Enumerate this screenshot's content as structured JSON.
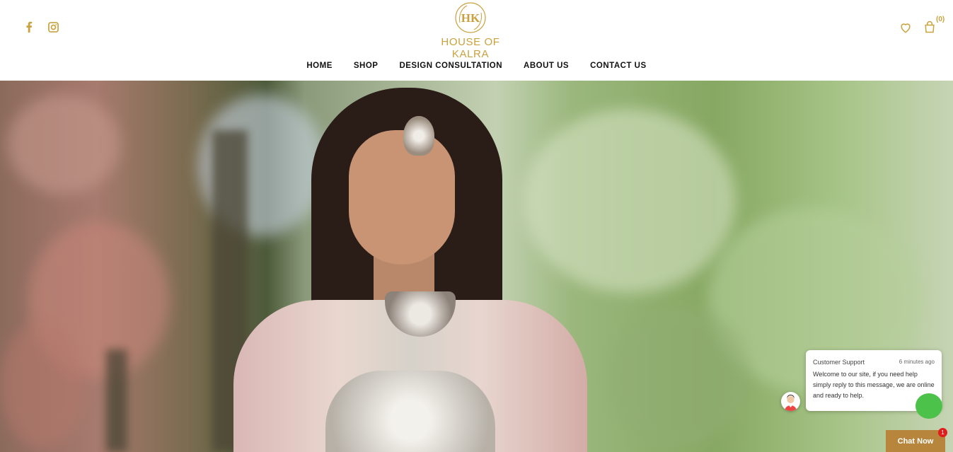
{
  "brand": {
    "monogram": "HK",
    "name": "HOUSE OF KALRA",
    "color": "#c9a23f"
  },
  "social": {
    "icons": [
      "facebook-icon",
      "instagram-icon"
    ]
  },
  "header_icons": {
    "wishlist_icon": "heart-icon",
    "cart_icon": "shopping-bag-icon",
    "cart_count": "(0)"
  },
  "nav": {
    "items": [
      {
        "label": "HOME"
      },
      {
        "label": "SHOP"
      },
      {
        "label": "DESIGN CONSULTATION"
      },
      {
        "label": "ABOUT US"
      },
      {
        "label": "CONTACT US"
      }
    ]
  },
  "chat": {
    "agent_name": "Customer Support",
    "time": "6 minutes ago",
    "message": "Welcome to our site, if you need help simply reply to this message, we are online and ready to help.",
    "button_label": "Chat Now",
    "unread_count": "1",
    "button_color": "#b7853b",
    "badge_color": "#e11c1c"
  }
}
